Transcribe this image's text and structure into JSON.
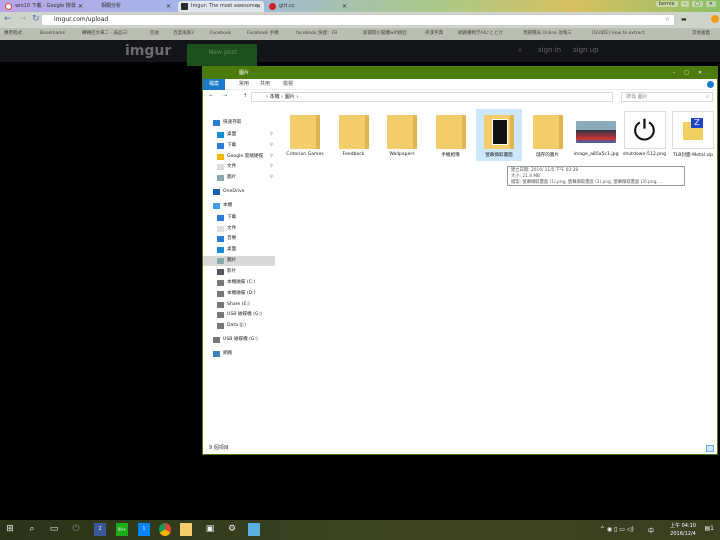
{
  "browser": {
    "tabs": [
      {
        "label": "win10 下載 - Google 搜尋",
        "color": "#ea4335"
      },
      {
        "label": "相關分析",
        "color": ""
      },
      {
        "label": "Imgur: The most awesome",
        "color": "#2b2b2b"
      },
      {
        "label": "gitt.cc",
        "color": "#c22"
      }
    ],
    "user": "bernie",
    "url": "imgur.com/upload",
    "bookmarks": [
      "應用程式",
      "Bookmarks",
      "轉轉巴大車二 - 誠品三!",
      "回收",
      "百度風暴3",
      "Facebook",
      "Facebook 手機",
      "facebook 快捷：FB",
      "新闘開小閣樓wifi桃娃",
      "英漢字典",
      "網路購物ぎAIにとどけ",
      "現搶戰局 Online 攻略三",
      "[GUIDE] How to extract",
      "其他書籤"
    ]
  },
  "imgur": {
    "logo": "imgur",
    "new_post": "New post",
    "sign_in": "sign in",
    "sign_up": "sign up"
  },
  "explorer": {
    "title": "圖片",
    "ribbon_tabs": [
      "檔案",
      "常用",
      "共用",
      "檢視"
    ],
    "path": [
      "本機",
      "圖片"
    ],
    "search_placeholder": "搜尋 圖片",
    "nav": [
      {
        "label": "快速存取",
        "icon": "star-icon",
        "group": true
      },
      {
        "label": "桌面",
        "icon": "desktop-icon",
        "pin": true
      },
      {
        "label": "下載",
        "icon": "download-icon",
        "pin": true
      },
      {
        "label": "Google 雲端硬碟",
        "icon": "google-drive-icon",
        "pin": true
      },
      {
        "label": "文件",
        "icon": "document-icon",
        "pin": true
      },
      {
        "label": "圖片",
        "icon": "pictures-icon",
        "pin": true
      },
      {
        "label": "OneDrive",
        "icon": "onedrive-icon",
        "group": true
      },
      {
        "label": "本機",
        "icon": "computer-icon",
        "group": true
      },
      {
        "label": "下載",
        "icon": "download-icon"
      },
      {
        "label": "文件",
        "icon": "document-icon"
      },
      {
        "label": "音樂",
        "icon": "music-icon"
      },
      {
        "label": "桌面",
        "icon": "desktop-icon"
      },
      {
        "label": "圖片",
        "icon": "pictures-icon",
        "selected": true
      },
      {
        "label": "影片",
        "icon": "video-icon"
      },
      {
        "label": "本機磁碟 (C:)",
        "icon": "drive-icon"
      },
      {
        "label": "本機磁碟 (D:)",
        "icon": "drive-icon"
      },
      {
        "label": "Share (E:)",
        "icon": "drive-icon"
      },
      {
        "label": "USB 磁碟機 (G:)",
        "icon": "drive-icon"
      },
      {
        "label": "Data (J:)",
        "icon": "drive-icon"
      },
      {
        "label": "USB 磁碟機 (G:)",
        "icon": "usb-icon",
        "group": true
      },
      {
        "label": "網路",
        "icon": "network-icon",
        "group": true
      }
    ],
    "items": [
      {
        "name": "Criterion Games",
        "type": "folder"
      },
      {
        "name": "Feedback",
        "type": "folder"
      },
      {
        "name": "Wallpapers",
        "type": "folder"
      },
      {
        "name": "手機相簿",
        "type": "folder"
      },
      {
        "name": "螢幕擷取畫面",
        "type": "folder",
        "selected": true
      },
      {
        "name": "儲存的圖片",
        "type": "folder"
      },
      {
        "name": "image_a85a5c1.jpg",
        "type": "photo"
      },
      {
        "name": "shutdown-512.png",
        "type": "power"
      },
      {
        "name": "TLB封面-Metal.zip",
        "type": "zip"
      }
    ],
    "tooltip": [
      "建立日期: 2016/ 11/5 下午 02:38",
      "大小: 21.4 MB",
      "檔案: 螢幕擷取畫面 (1).png, 螢幕擷取畫面 (2).png, 螢幕擷取畫面 (3).png, ..."
    ],
    "status": "9 個項目"
  },
  "taskbar": {
    "badges": [
      "2",
      "99+",
      "1"
    ],
    "ime": "中",
    "time": "上午 04:10",
    "date": "2016/12/4",
    "notif": "1"
  }
}
